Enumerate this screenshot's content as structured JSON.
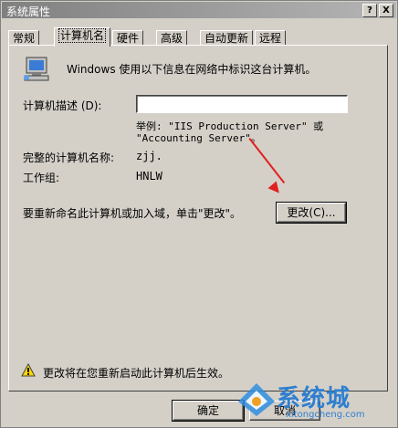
{
  "window": {
    "title": "系统属性",
    "help_btn": "?",
    "close_btn": "X"
  },
  "tabs": [
    "常规",
    "计算机名",
    "硬件",
    "高级",
    "自动更新",
    "远程"
  ],
  "panel": {
    "intro": "Windows 使用以下信息在网络中标识这台计算机。",
    "description_label": "计算机描述 (D):",
    "description_value": "",
    "example_line1": "举例: \"IIS Production Server\" 或",
    "example_line2": "\"Accounting Server\"。",
    "fullname_label": "完整的计算机名称:",
    "fullname_value": "zjj.",
    "workgroup_label": "工作组:",
    "workgroup_value": "HNLW",
    "rename_text": "要重新命名此计算机或加入域，单击\"更改\"。",
    "change_button": "更改(C)...",
    "warning_text": "更改将在您重新启动此计算机后生效。"
  },
  "footer": {
    "ok_button": "确定",
    "cancel_button": "取消"
  },
  "watermark": {
    "brand": "系统城",
    "url": "xitongcheng.com"
  },
  "colors": {
    "window_bg": "#d4d0c8",
    "arrow": "#e02020",
    "watermark": "#2f7fd0"
  }
}
